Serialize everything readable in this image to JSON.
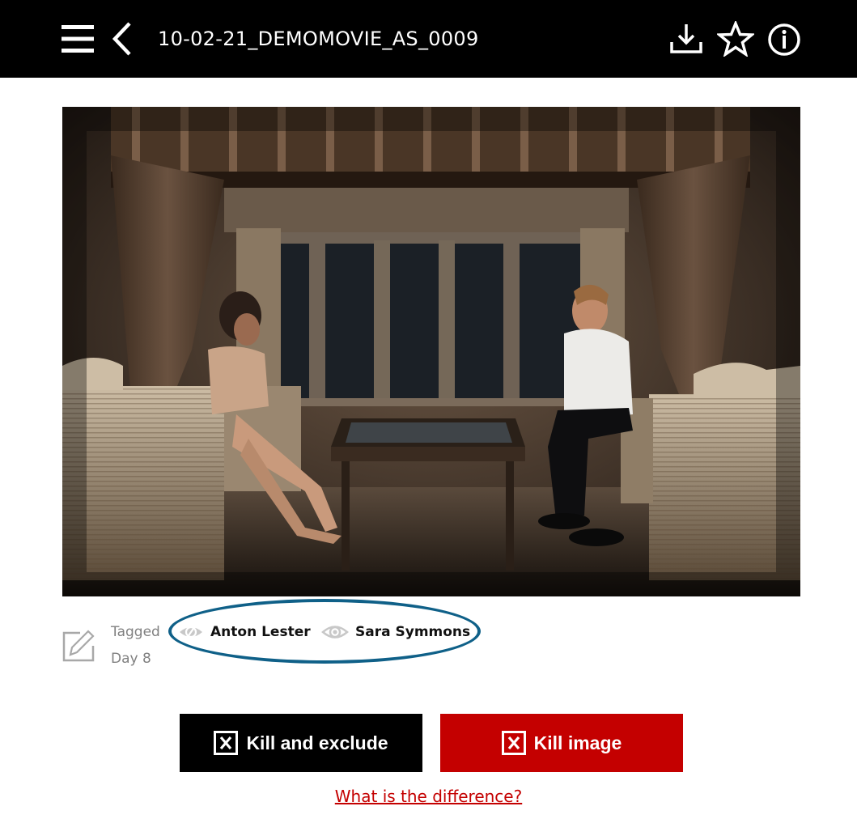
{
  "header": {
    "title": "10-02-21_DEMOMOVIE_AS_0009",
    "icons": {
      "menu": "hamburger-menu-icon",
      "back": "chevron-left-icon",
      "download": "download-icon",
      "favorite": "star-outline-icon",
      "info": "info-circle-icon"
    }
  },
  "image": {
    "alt": "Film still: a woman and a man seated on striped armchairs on either side of a glass coffee table in a dim curtained room",
    "icon": "photo"
  },
  "metadata": {
    "edit_icon": "pencil-edit-icon",
    "tagged_label": "Tagged",
    "day_label": "Day 8",
    "tags": [
      {
        "name": "Anton Lester",
        "visibility": "hidden",
        "icon": "eye-slash-icon"
      },
      {
        "name": "Sara Symmons",
        "visibility": "visible",
        "icon": "eye-icon"
      }
    ],
    "highlight_color": "#0f6088"
  },
  "actions": {
    "kill_and_exclude_label": "Kill and exclude",
    "kill_image_label": "Kill image",
    "difference_link": "What is the difference?"
  },
  "colors": {
    "header_bg": "#000000",
    "kill_exclude_bg": "#000000",
    "kill_image_bg": "#c40000",
    "link": "#c40000",
    "muted_text": "#808080"
  }
}
